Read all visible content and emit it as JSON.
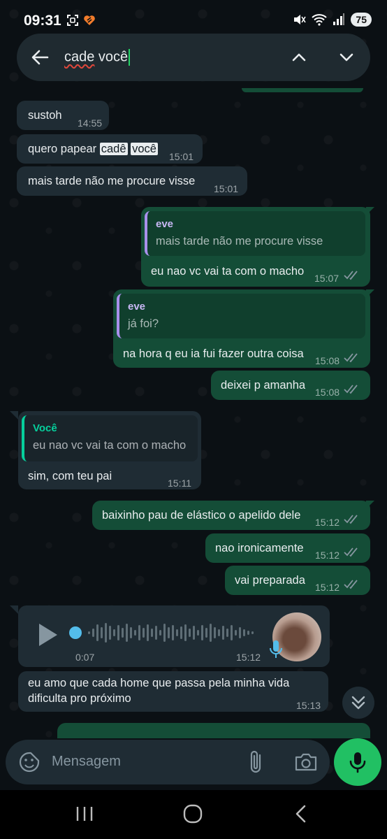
{
  "status_bar": {
    "time": "09:31",
    "battery": "75"
  },
  "search": {
    "query_part1": "cade",
    "query_part2": " você"
  },
  "messages": [
    {
      "text": "sustoh",
      "time": "14:55"
    },
    {
      "text_before": "quero papear ",
      "highlight1": "cadê",
      "highlight2": "você",
      "time": "15:01"
    },
    {
      "text": "mais tarde não me procure visse",
      "time": "15:01"
    },
    {
      "quote_name": "eve",
      "quote_text": "mais tarde não me procure visse",
      "text": "eu nao vc vai ta com o macho",
      "time": "15:07"
    },
    {
      "quote_name": "eve",
      "quote_text": "já foi?",
      "text": "na hora q eu ia fui fazer outra coisa",
      "time": "15:08"
    },
    {
      "text": "deixei p amanha",
      "time": "15:08"
    },
    {
      "quote_name": "Você",
      "quote_text": "eu nao vc vai ta com o macho",
      "text": "sim, com teu pai",
      "time": "15:11"
    },
    {
      "text": "baixinho pau de elástico o apelido dele",
      "time": "15:12"
    },
    {
      "text": "nao ironicamente",
      "time": "15:12"
    },
    {
      "text": "vai preparada",
      "time": "15:12"
    },
    {
      "duration": "0:07",
      "time": "15:12"
    },
    {
      "line1": "eu amo que cada home que passa pela minha vida",
      "line2": "dificulta pro próximo",
      "time": "15:13"
    }
  ],
  "composer": {
    "placeholder": "Mensagem"
  },
  "colors": {
    "incoming": "#1f2c34",
    "outgoing": "#144d37",
    "accent": "#21c063",
    "read_ticks": "#8696a0"
  }
}
